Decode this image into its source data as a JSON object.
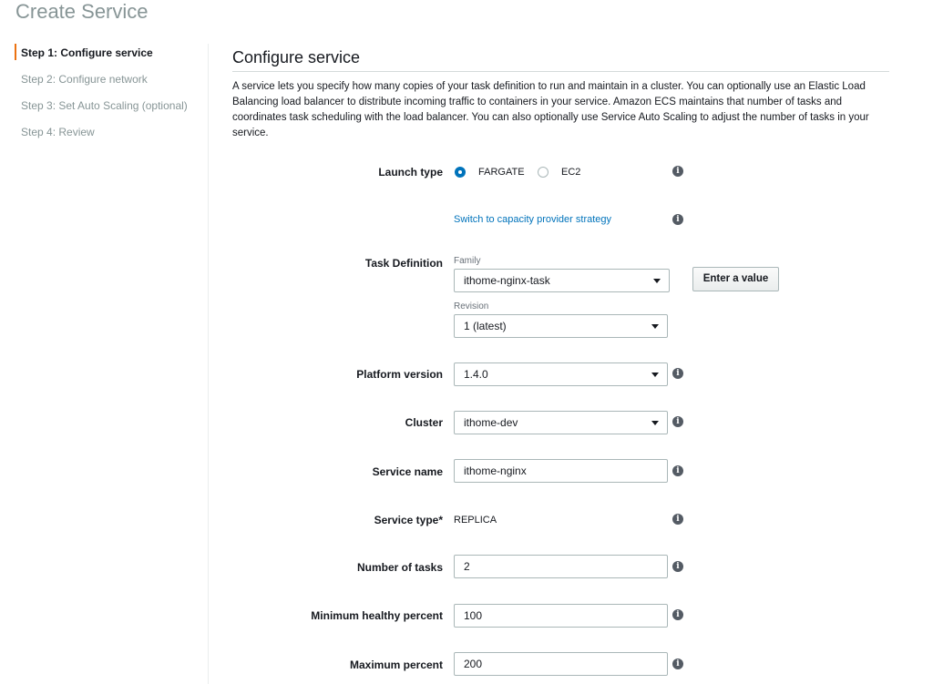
{
  "page": {
    "title": "Create Service"
  },
  "steps": [
    {
      "label": "Step 1: Configure service",
      "active": true
    },
    {
      "label": "Step 2: Configure network"
    },
    {
      "label": "Step 3: Set Auto Scaling (optional)"
    },
    {
      "label": "Step 4: Review"
    }
  ],
  "section": {
    "title": "Configure service",
    "description": "A service lets you specify how many copies of your task definition to run and maintain in a cluster. You can optionally use an Elastic Load Balancing load balancer to distribute incoming traffic to containers in your service. Amazon ECS maintains that number of tasks and coordinates task scheduling with the load balancer. You can also optionally use Service Auto Scaling to adjust the number of tasks in your service."
  },
  "form": {
    "launch_type": {
      "label": "Launch type",
      "options": [
        "FARGATE",
        "EC2"
      ],
      "selected": "FARGATE"
    },
    "capacity_link": "Switch to capacity provider strategy",
    "task_definition": {
      "label": "Task Definition",
      "family_label": "Family",
      "family_value": "ithome-nginx-task",
      "revision_label": "Revision",
      "revision_value": "1 (latest)",
      "enter_value_button": "Enter a value"
    },
    "platform_version": {
      "label": "Platform version",
      "value": "1.4.0"
    },
    "cluster": {
      "label": "Cluster",
      "value": "ithome-dev"
    },
    "service_name": {
      "label": "Service name",
      "value": "ithome-nginx"
    },
    "service_type": {
      "label": "Service type*",
      "value": "REPLICA"
    },
    "number_of_tasks": {
      "label": "Number of tasks",
      "value": "2"
    },
    "min_healthy": {
      "label": "Minimum healthy percent",
      "value": "100"
    },
    "max_percent": {
      "label": "Maximum percent",
      "value": "200"
    }
  },
  "info_icon": "info-circle-icon",
  "colors": {
    "accent": "#ec7211",
    "link": "#0073bb",
    "muted": "#879596"
  }
}
